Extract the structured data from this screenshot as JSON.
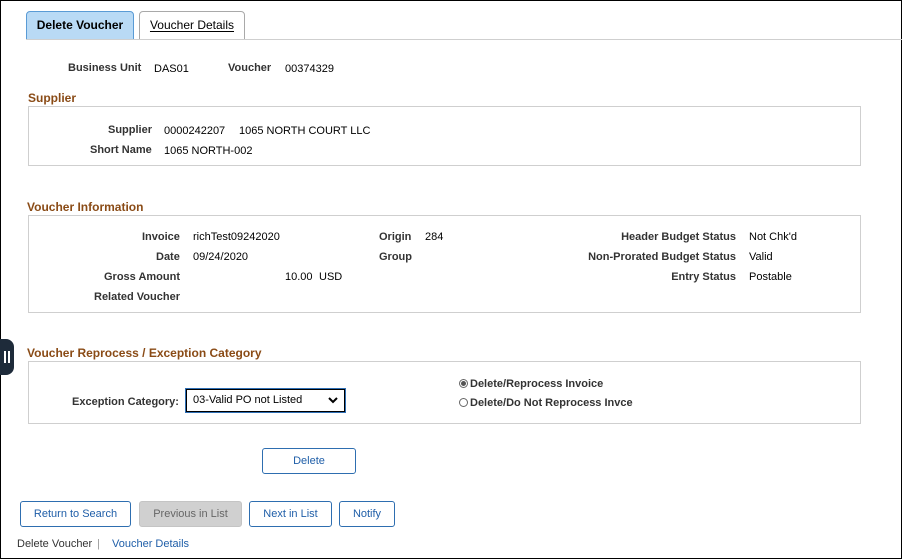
{
  "tabs": [
    {
      "label": "Delete Voucher",
      "active": true
    },
    {
      "label": "Voucher Details",
      "active": false
    }
  ],
  "header": {
    "business_unit_label": "Business Unit",
    "business_unit_value": "DAS01",
    "voucher_label": "Voucher",
    "voucher_value": "00374329"
  },
  "supplier": {
    "section_title": "Supplier",
    "supplier_label": "Supplier",
    "supplier_id": "0000242207",
    "supplier_name": "1065 NORTH COURT LLC",
    "short_name_label": "Short Name",
    "short_name_value": "1065 NORTH-002"
  },
  "voucher_info": {
    "section_title": "Voucher Information",
    "invoice_label": "Invoice",
    "invoice_value": "richTest09242020",
    "date_label": "Date",
    "date_value": "09/24/2020",
    "gross_amount_label": "Gross Amount",
    "gross_amount_value": "10.00",
    "currency": "USD",
    "related_voucher_label": "Related Voucher",
    "origin_label": "Origin",
    "origin_value": "284",
    "group_label": "Group",
    "header_budget_status_label": "Header Budget Status",
    "header_budget_status_value": "Not Chk'd",
    "non_prorated_label": "Non-Prorated Budget Status",
    "non_prorated_value": "Valid",
    "entry_status_label": "Entry Status",
    "entry_status_value": "Postable"
  },
  "reprocess": {
    "section_title": "Voucher Reprocess / Exception Category",
    "exception_category_label": "Exception Category:",
    "exception_category_value": "03-Valid PO not Listed",
    "radio_options": [
      {
        "label": "Delete/Reprocess Invoice",
        "selected": true
      },
      {
        "label": "Delete/Do Not Reprocess Invce",
        "selected": false
      }
    ]
  },
  "delete_button": "Delete",
  "bottom_buttons": [
    {
      "label": "Return to Search",
      "enabled": true
    },
    {
      "label": "Previous in List",
      "enabled": false
    },
    {
      "label": "Next in List",
      "enabled": true
    },
    {
      "label": "Notify",
      "enabled": true
    }
  ],
  "footer_links": [
    {
      "label": "Delete Voucher",
      "current": true
    },
    {
      "label": "Voucher Details",
      "current": false
    }
  ],
  "colors": {
    "section_title": "#8a4b16",
    "active_tab_bg": "#b9daf5",
    "button_border": "#2e6eb0",
    "link": "#1f5ea8"
  }
}
